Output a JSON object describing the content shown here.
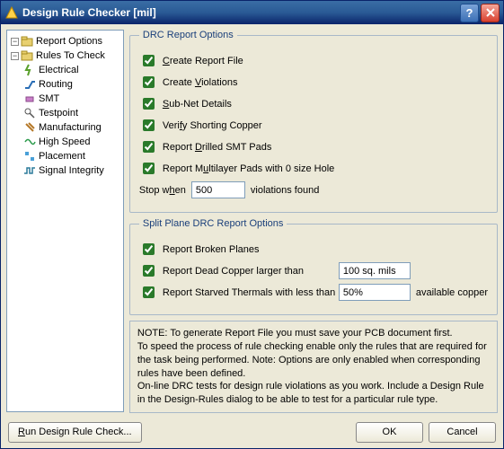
{
  "window": {
    "title": "Design Rule Checker [mil]"
  },
  "tree": {
    "report_options": "Report Options",
    "rules_to_check": "Rules To Check",
    "electrical": "Electrical",
    "routing": "Routing",
    "smt": "SMT",
    "testpoint": "Testpoint",
    "manufacturing": "Manufacturing",
    "high_speed": "High Speed",
    "placement": "Placement",
    "signal_integrity": "Signal Integrity"
  },
  "group1": {
    "legend": "DRC Report Options",
    "create_report_file": "Create Report File",
    "create_violations": "Create Violations",
    "sub_net_details": "Sub-Net Details",
    "verify_shorting_copper": "Verify Shorting Copper",
    "report_drilled_smt_pads": "Report Drilled SMT Pads",
    "report_multilayer_pads": "Report Multilayer Pads with 0 size Hole",
    "stop_when_pre": "Stop when",
    "stop_when_value": "500",
    "stop_when_post": "violations found"
  },
  "group2": {
    "legend": "Split Plane DRC Report Options",
    "report_broken_planes": "Report Broken Planes",
    "report_dead_copper": "Report Dead Copper larger than",
    "dead_copper_value": "100 sq. mils",
    "report_starved_thermals": "Report Starved Thermals with less than",
    "starved_value": "50%",
    "starved_post": "available copper"
  },
  "note": {
    "l1": "NOTE: To generate Report File you must save your PCB document first.",
    "l2": "To speed the process of rule checking enable only the rules that are required for the task being performed.  Note: Options are only enabled when corresponding rules have been defined.",
    "l3": "On-line DRC tests for design rule violations as you work. Include a Design Rule in the Design-Rules dialog to be able to test for a particular rule  type."
  },
  "buttons": {
    "run": "Run Design Rule Check...",
    "ok": "OK",
    "cancel": "Cancel"
  }
}
